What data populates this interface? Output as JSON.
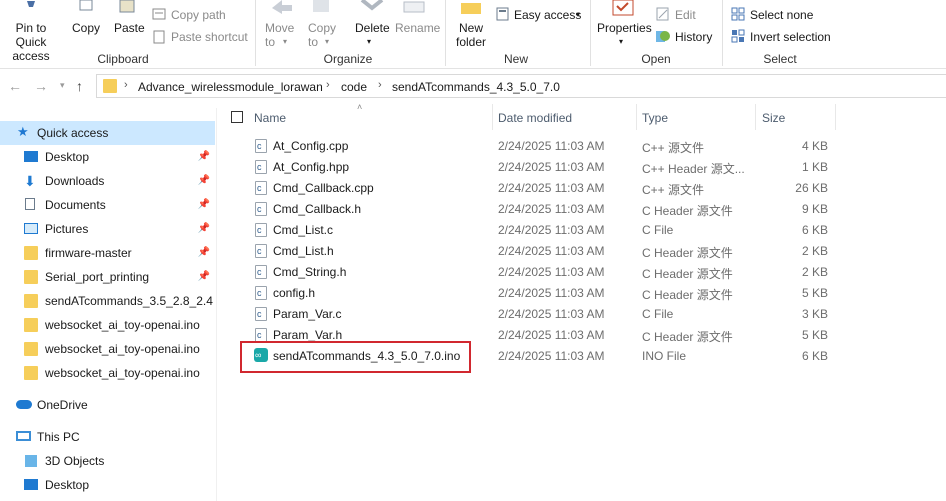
{
  "ribbon": {
    "clipboard": {
      "pin_label": "Pin to Quick\naccess",
      "copy": "Copy",
      "paste": "Paste",
      "copy_path": "Copy path",
      "paste_shortcut": "Paste shortcut",
      "group": "Clipboard"
    },
    "organize": {
      "move_to": "Move\nto",
      "copy_to": "Copy\nto",
      "delete": "Delete",
      "rename": "Rename",
      "group": "Organize"
    },
    "new": {
      "new_folder": "New\nfolder",
      "easy_access": "Easy access",
      "group": "New"
    },
    "open": {
      "properties": "Properties",
      "edit": "Edit",
      "history": "History",
      "group": "Open"
    },
    "select": {
      "select_none": "Select none",
      "invert_selection": "Invert selection",
      "group": "Select"
    }
  },
  "address": {
    "crumbs": [
      "Advance_wirelessmodule_lorawan",
      "code",
      "sendATcommands_4.3_5.0_7.0"
    ]
  },
  "nav": {
    "quick_access": "Quick access",
    "items": [
      "Desktop",
      "Downloads",
      "Documents",
      "Pictures",
      "firmware-master",
      "Serial_port_printing",
      "sendATcommands_3.5_2.8_2.4",
      "websocket_ai_toy-openai.ino",
      "websocket_ai_toy-openai.ino",
      "websocket_ai_toy-openai.ino"
    ],
    "onedrive": "OneDrive",
    "this_pc": "This PC",
    "pc_items": [
      "3D Objects",
      "Desktop"
    ]
  },
  "columns": {
    "name": "Name",
    "date": "Date modified",
    "type": "Type",
    "size": "Size"
  },
  "files": [
    {
      "name": "At_Config.cpp",
      "date": "2/24/2025 11:03 AM",
      "type": "C++ 源文件",
      "size": "4 KB"
    },
    {
      "name": "At_Config.hpp",
      "date": "2/24/2025 11:03 AM",
      "type": "C++ Header 源文...",
      "size": "1 KB"
    },
    {
      "name": "Cmd_Callback.cpp",
      "date": "2/24/2025 11:03 AM",
      "type": "C++ 源文件",
      "size": "26 KB"
    },
    {
      "name": "Cmd_Callback.h",
      "date": "2/24/2025 11:03 AM",
      "type": "C Header 源文件",
      "size": "9 KB"
    },
    {
      "name": "Cmd_List.c",
      "date": "2/24/2025 11:03 AM",
      "type": "C File",
      "size": "6 KB"
    },
    {
      "name": "Cmd_List.h",
      "date": "2/24/2025 11:03 AM",
      "type": "C Header 源文件",
      "size": "2 KB"
    },
    {
      "name": "Cmd_String.h",
      "date": "2/24/2025 11:03 AM",
      "type": "C Header 源文件",
      "size": "2 KB"
    },
    {
      "name": "config.h",
      "date": "2/24/2025 11:03 AM",
      "type": "C Header 源文件",
      "size": "5 KB"
    },
    {
      "name": "Param_Var.c",
      "date": "2/24/2025 11:03 AM",
      "type": "C File",
      "size": "3 KB"
    },
    {
      "name": "Param_Var.h",
      "date": "2/24/2025 11:03 AM",
      "type": "C Header 源文件",
      "size": "5 KB"
    },
    {
      "name": "sendATcommands_4.3_5.0_7.0.ino",
      "date": "2/24/2025 11:03 AM",
      "type": "INO File",
      "size": "6 KB"
    }
  ],
  "colors": {
    "accent": "#0078d7",
    "highlight_border": "#d1282f",
    "folder": "#f6ce5a",
    "selected_bg": "#cce8ff"
  }
}
